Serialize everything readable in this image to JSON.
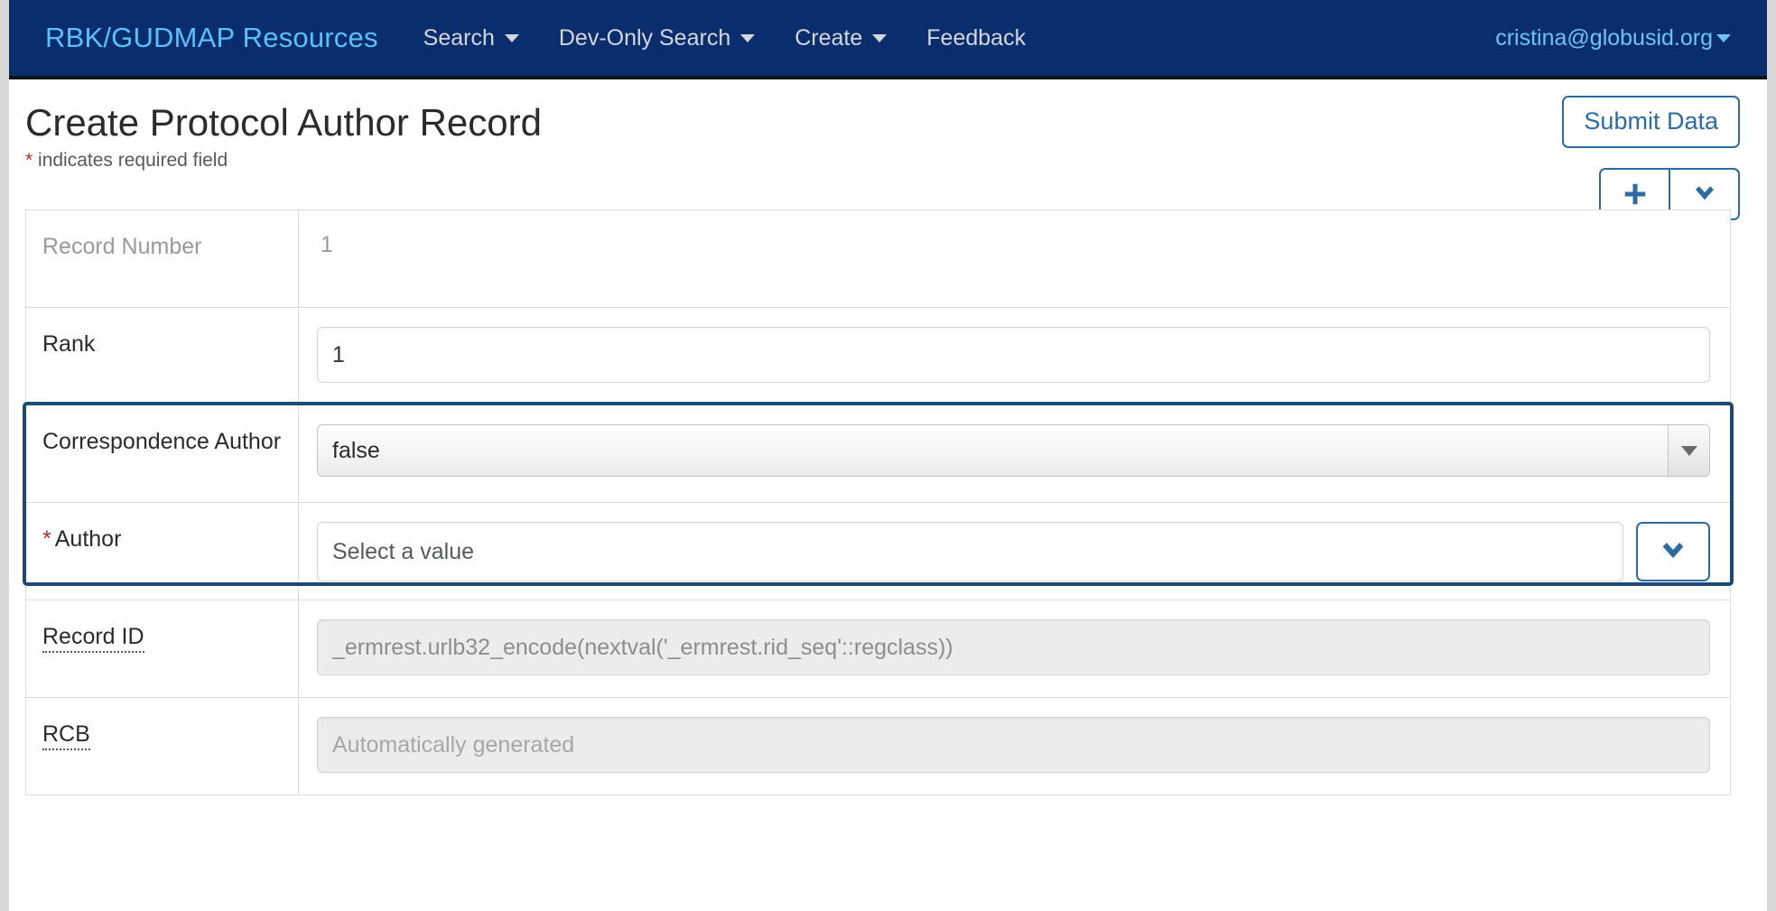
{
  "navbar": {
    "brand": "RBK/GUDMAP Resources",
    "links": [
      {
        "label": "Search",
        "has_caret": true,
        "icon": "chevron-down-icon"
      },
      {
        "label": "Dev-Only Search",
        "has_caret": true,
        "icon": "chevron-down-icon"
      },
      {
        "label": "Create",
        "has_caret": true,
        "icon": "chevron-down-icon"
      },
      {
        "label": "Feedback",
        "has_caret": false,
        "icon": ""
      }
    ],
    "user": "cristina@globusid.org",
    "user_caret_icon": "caret-down-icon",
    "background_color": "#0a2d6e",
    "brand_color": "#5bc0f8",
    "link_color": "#d4d7da"
  },
  "header": {
    "title": "Create Protocol Author Record",
    "required_star": "*",
    "required_note": "indicates required field",
    "required_star_color": "#b03030"
  },
  "actions": {
    "submit_label": "Submit Data",
    "add_icon": "plus-icon",
    "more_icon": "chevron-down-icon",
    "accent_color": "#2d6ca2"
  },
  "form": {
    "rows": [
      {
        "label": "Record Number",
        "label_muted": true,
        "required": false,
        "tooltip_underline": false,
        "control": "static",
        "value": "1"
      },
      {
        "label": "Rank",
        "label_muted": false,
        "required": false,
        "tooltip_underline": false,
        "control": "text",
        "value": "1",
        "placeholder": ""
      },
      {
        "label": "Correspondence Author",
        "label_muted": false,
        "required": false,
        "tooltip_underline": false,
        "control": "select",
        "value": "false",
        "options": [
          "false",
          "true"
        ],
        "arrow_icon": "triangle-down-icon"
      },
      {
        "label": "Author",
        "label_muted": false,
        "required": true,
        "tooltip_underline": false,
        "control": "foreignkey",
        "value": "",
        "placeholder": "Select a value",
        "button_icon": "chevron-down-icon"
      },
      {
        "label": "Record ID",
        "label_muted": false,
        "required": false,
        "tooltip_underline": true,
        "control": "text-disabled",
        "value": "_ermrest.urlb32_encode(nextval('_ermrest.rid_seq'::regclass))",
        "placeholder": ""
      },
      {
        "label": "RCB",
        "label_muted": false,
        "required": false,
        "tooltip_underline": true,
        "control": "text-disabled",
        "value": "",
        "placeholder": "Automatically generated"
      }
    ],
    "highlight_color": "#1d4a73",
    "highlight_rows": [
      2,
      3
    ]
  }
}
